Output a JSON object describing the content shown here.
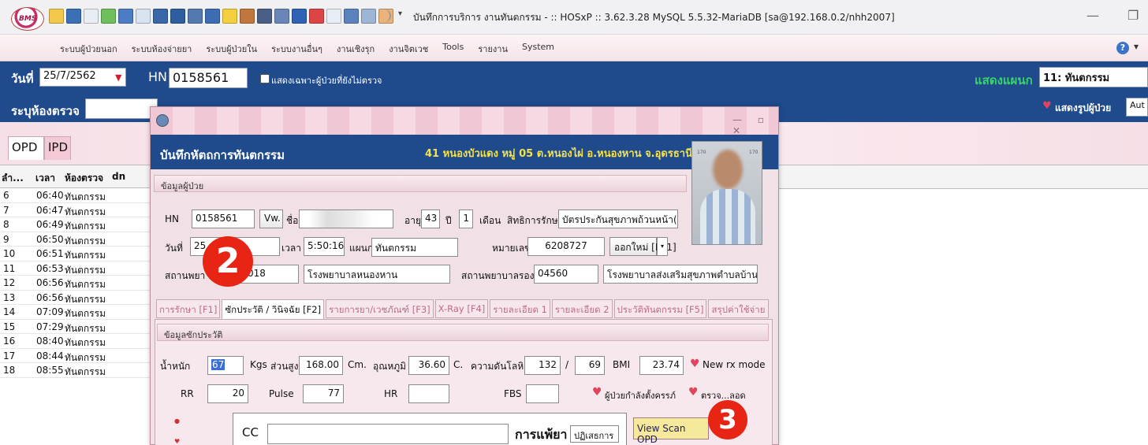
{
  "titlebar": {
    "logo_text": "BMS",
    "title": "บันทึกการบริการ งานทันตกรรม - :: HOSxP :: 3.62.3.28 MySQL 5.5.32-MariaDB [sa@192.168.0.2/nhh2007]",
    "quick_toolbar_more": "▾",
    "minimize": "—",
    "restore": "❐"
  },
  "menu": {
    "items": [
      "ระบบผู้ป่วยนอก",
      "ระบบห้องจ่ายยา",
      "ระบบผู้ป่วยใน",
      "ระบบงานอื่นๆ",
      "งานเชิงรุก",
      "งานจิตเวช",
      "Tools",
      "รายงาน",
      "System"
    ],
    "help": "?",
    "help_drop": "▾"
  },
  "filter": {
    "date_label": "วันที่",
    "date_value": "25/7/2562",
    "date_drop": "▼",
    "hn_label": "HN",
    "hn_value": "0158561",
    "unexamined_only_label": "แสดงเฉพาะผู้ป่วยที่ยังไม่ตรวจ",
    "room_label": "ระบุห้องตรวจ",
    "room_value": "",
    "dept_label": "แสดงแผนก",
    "dept_value": "11: ทันตกรรม",
    "show_photo_label": "แสดงรูปผู้ป่วย",
    "auto_value": "Aut"
  },
  "left_tabs": {
    "opd": "OPD",
    "ipd": "IPD"
  },
  "queue": {
    "headers": [
      "ลำ...",
      "เวลา",
      "ห้องตรวจ",
      "dn"
    ],
    "rows": [
      {
        "no": "6",
        "time": "06:40",
        "room": "ทันตกรรม"
      },
      {
        "no": "7",
        "time": "06:47",
        "room": "ทันตกรรม"
      },
      {
        "no": "8",
        "time": "06:49",
        "room": "ทันตกรรม"
      },
      {
        "no": "9",
        "time": "06:50",
        "room": "ทันตกรรม"
      },
      {
        "no": "10",
        "time": "06:51",
        "room": "ทันตกรรม"
      },
      {
        "no": "11",
        "time": "06:53",
        "room": "ทันตกรรม"
      },
      {
        "no": "12",
        "time": "06:56",
        "room": "ทันตกรรม"
      },
      {
        "no": "13",
        "time": "06:56",
        "room": "ทันตกรรม"
      },
      {
        "no": "14",
        "time": "07:09",
        "room": "ทันตกรรม"
      },
      {
        "no": "15",
        "time": "07:29",
        "room": "ทันตกรรม"
      },
      {
        "no": "16",
        "time": "08:40",
        "room": "ทันตกรรม"
      },
      {
        "no": "17",
        "time": "08:44",
        "room": "ทันตกรรม"
      },
      {
        "no": "18",
        "time": "08:55",
        "room": "ทันตกรรม"
      }
    ]
  },
  "dialog": {
    "caption_winbtns": "— ▫ ✕",
    "title": "บันทึกหัตถการทันตกรรม",
    "address": "41 หนองบัวแดง หมู่ 05 ต.หนองไผ่ อ.หนองหาน จ.อุดรธานี",
    "patient_section": "ข้อมูลผู้ป่วย",
    "hn_label": "HN",
    "hn_value": "0158561",
    "vw_button": "Vw.",
    "name_label": "ชื่อ",
    "name_value": "",
    "age_label": "อายุ",
    "age_years": "43",
    "years_unit": "ปี",
    "age_months": "1",
    "months_unit": "เดือน",
    "right_label": "สิทธิการรักษา",
    "right_value": "บัตรประกันสุขภาพถ้วนหน้า(UCS",
    "date_label": "วันที่",
    "date_value": "25",
    "time_label": "เวลา",
    "time_value": "5:50:16",
    "dept_label": "แผนก",
    "dept_value": "ทันตกรรม",
    "dn_label": "หมายเลข DN",
    "dn_value": "6208727",
    "new_dn_button": "ออกใหม่ [F11]",
    "new_dn_drop": "▾",
    "hospital_label": "สถานพยา",
    "hospital_code": "018",
    "hospital_name": "โรงพยาบาลหนองหาน",
    "sub_hospital_label": "สถานพยาบาลรอง",
    "sub_hospital_code": "04560",
    "sub_hospital_name": "โรงพยาบาลส่งเสริมสุขภาพตำบลบ้านหนองบัว",
    "photo_scale_left": "170",
    "photo_scale_right": "170",
    "tabs": [
      "การรักษา [F1]",
      "ซักประวัติ / วินิจฉัย [F2]",
      "รายการยา/เวชภัณฑ์ [F3]",
      "X-Ray [F4]",
      "รายละเอียด 1",
      "รายละเอียด 2",
      "ประวัติทันตกรรม [F5]",
      "สรุปค่าใช้จ่าย"
    ],
    "history_section": "ข้อมูลซักประวัติ",
    "weight_label": "น้ำหนัก",
    "weight_value": "67",
    "weight_unit": "Kgs",
    "height_label": "ส่วนสูง",
    "height_value": "168.00",
    "height_unit": "Cm.",
    "temp_label": "อุณหภูมิ",
    "temp_value": "36.60",
    "temp_unit": "C.",
    "bp_label": "ความดันโลหิต",
    "bp_sys": "132",
    "bp_sep": "/",
    "bp_dia": "69",
    "bmi_label": "BMI",
    "bmi_value": "23.74",
    "new_rx_label": "New rx mode",
    "rr_label": "RR",
    "rr_value": "20",
    "pulse_label": "Pulse",
    "pulse_value": "77",
    "hr_label": "HR",
    "hr_value": "",
    "fbs_label": "FBS",
    "fbs_value": "",
    "pregnant_label": "ผู้ป่วยกำลังตั้งครรภ์",
    "check_label": "ตรวจ...ลอด",
    "cc_label": "CC",
    "cc_value": "",
    "allergy_label": "การแพ้ยา",
    "allergy_value": "ปฏิเสธการแ",
    "view_scan_button": "View Scan OPD"
  },
  "markers": {
    "m2": "2",
    "m3": "3"
  },
  "colors": {
    "header_blue": "#1f4a8c",
    "accent_pink": "#f1e1e6",
    "marker_red": "#e82414",
    "dept_green": "#39d46b",
    "address_yellow": "#f3e24a"
  }
}
